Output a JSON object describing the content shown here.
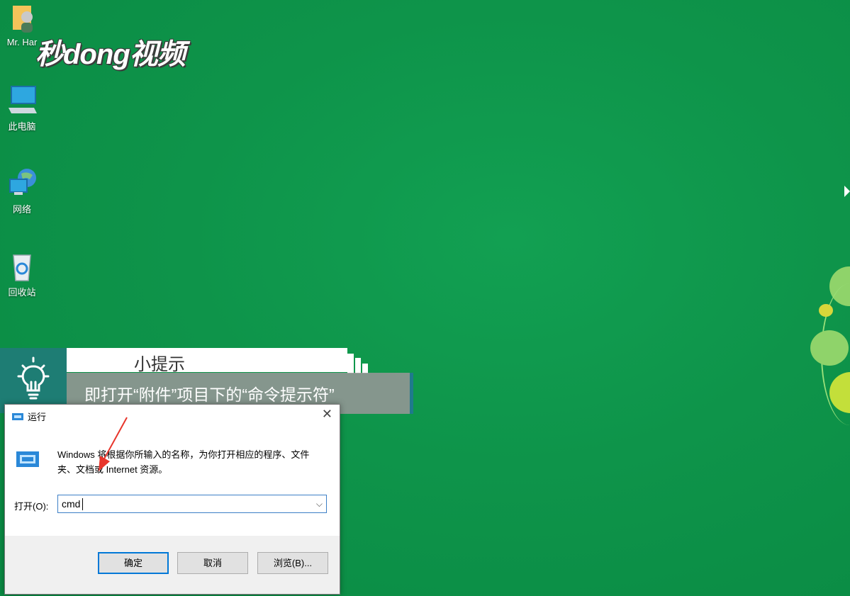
{
  "desktop": {
    "icons": [
      {
        "label": "Mr. Har"
      },
      {
        "label": "此电脑"
      },
      {
        "label": "网络"
      },
      {
        "label": "回收站"
      }
    ]
  },
  "watermark": {
    "text": "秒dong视频"
  },
  "tip": {
    "title": "小提示",
    "text": "即打开“附件”项目下的“命令提示符”"
  },
  "run_dialog": {
    "title": "运行",
    "description": "Windows 将根据你所输入的名称，为你打开相应的程序、文件夹、文档或 Internet 资源。",
    "open_label": "打开(O):",
    "input_value": "cmd",
    "buttons": {
      "ok": "确定",
      "cancel": "取消",
      "browse": "浏览(B)..."
    }
  },
  "colors": {
    "desktop_bg": "#0e944a",
    "tip_accent": "#1e7d74",
    "focus_border": "#0078d7"
  }
}
